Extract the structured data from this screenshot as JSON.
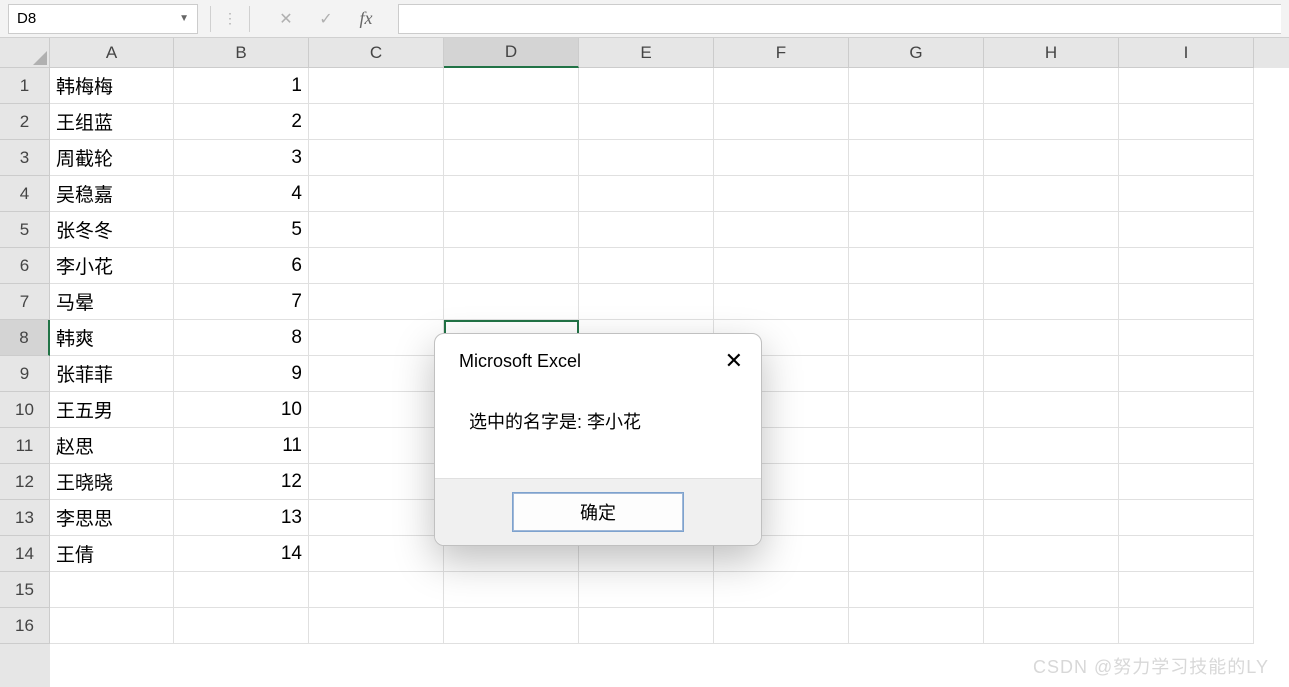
{
  "namebox": {
    "value": "D8"
  },
  "formula": {
    "value": ""
  },
  "columns": [
    "A",
    "B",
    "C",
    "D",
    "E",
    "F",
    "G",
    "H",
    "I"
  ],
  "activeCol": "D",
  "activeRow": 8,
  "rowCount": 16,
  "data": [
    {
      "a": "韩梅梅",
      "b": "1"
    },
    {
      "a": "王组蓝",
      "b": "2"
    },
    {
      "a": "周截轮",
      "b": "3"
    },
    {
      "a": "吴稳嘉",
      "b": "4"
    },
    {
      "a": "张冬冬",
      "b": "5"
    },
    {
      "a": "李小花",
      "b": "6"
    },
    {
      "a": "马晕",
      "b": "7"
    },
    {
      "a": "韩爽",
      "b": "8"
    },
    {
      "a": "张菲菲",
      "b": "9"
    },
    {
      "a": "王五男",
      "b": "10"
    },
    {
      "a": "赵思",
      "b": "11"
    },
    {
      "a": "王晓晓",
      "b": "12"
    },
    {
      "a": "李思思",
      "b": "13"
    },
    {
      "a": "王倩",
      "b": "14"
    }
  ],
  "dialog": {
    "title": "Microsoft Excel",
    "message": "选中的名字是: 李小花",
    "ok": "确定"
  },
  "watermark": "CSDN @努力学习技能的LY"
}
